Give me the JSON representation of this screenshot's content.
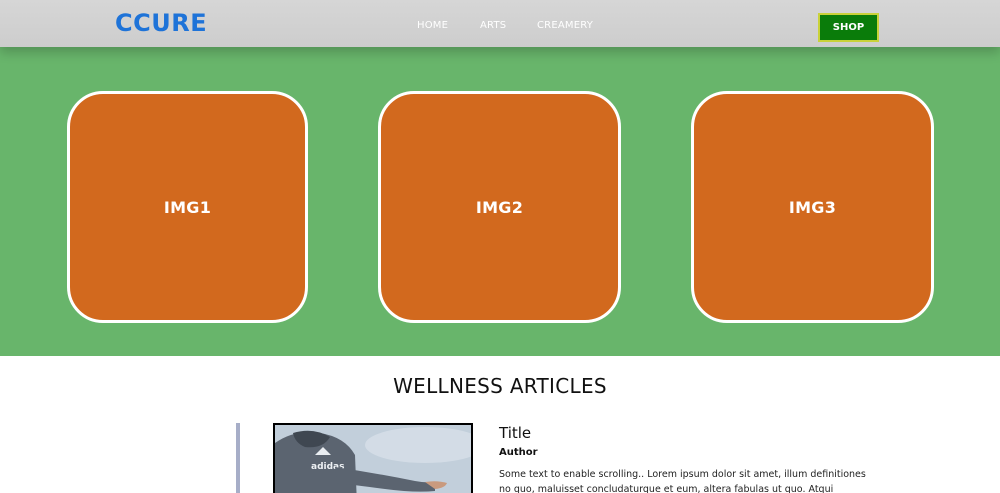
{
  "header": {
    "logo": "CCURE",
    "nav": [
      {
        "label": "HOME"
      },
      {
        "label": "ARTS"
      },
      {
        "label": "CREAMERY"
      }
    ],
    "shop_label": "SHOP"
  },
  "hero": {
    "background": "#68b56b",
    "tile_color": "#d2691e",
    "tiles": [
      {
        "label": "IMG1"
      },
      {
        "label": "IMG2"
      },
      {
        "label": "IMG3"
      }
    ]
  },
  "articles": {
    "section_title": "WELLNESS ARTICLES",
    "items": [
      {
        "title": "Title",
        "author": "Author",
        "text": "Some text to enable scrolling.. Lorem ipsum dolor sit amet, illum definitiones no quo, maluisset concludaturque et eum, altera fabulas ut quo. Atqui causae"
      }
    ]
  }
}
